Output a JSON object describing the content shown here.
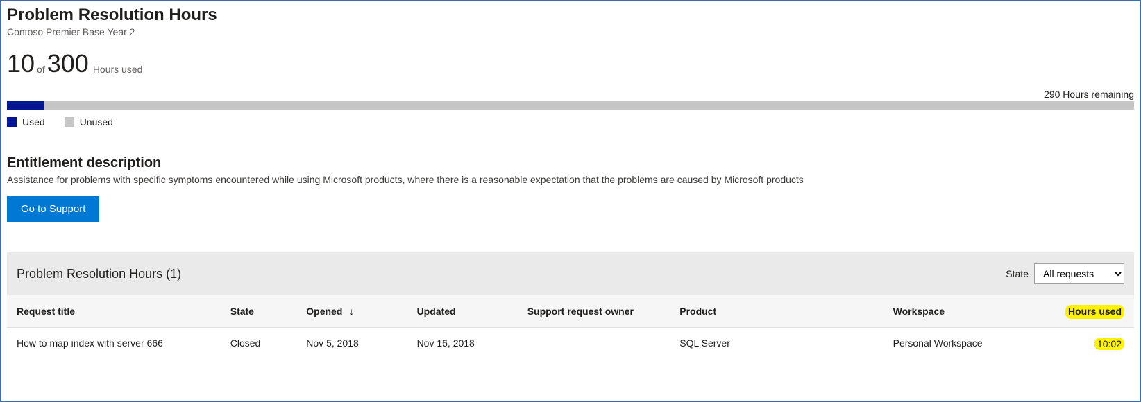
{
  "header": {
    "title": "Problem Resolution Hours",
    "subtitle": "Contoso Premier Base Year 2"
  },
  "usage": {
    "used": "10",
    "of_label": "of",
    "total": "300",
    "hours_used_label": "Hours used",
    "remaining_label": "290 Hours remaining",
    "progress_percent": 3.33
  },
  "legend": {
    "used": "Used",
    "unused": "Unused"
  },
  "entitlement": {
    "title": "Entitlement description",
    "description": "Assistance for problems with specific symptoms encountered while using Microsoft products, where there is a reasonable expectation that the problems are caused by Microsoft products",
    "button": "Go to Support"
  },
  "tableSection": {
    "title": "Problem Resolution Hours (1)",
    "state_label": "State",
    "state_selected": "All requests"
  },
  "columns": {
    "request_title": "Request title",
    "state": "State",
    "opened": "Opened",
    "updated": "Updated",
    "owner": "Support request owner",
    "product": "Product",
    "workspace": "Workspace",
    "hours_used": "Hours used"
  },
  "sort_indicator": "↓",
  "rows": [
    {
      "title": "How to map index with server 666",
      "state": "Closed",
      "opened": "Nov 5, 2018",
      "updated": "Nov 16, 2018",
      "owner": "",
      "product": "SQL Server",
      "workspace": "Personal Workspace",
      "hours_used": "10:02"
    }
  ],
  "colors": {
    "accent": "#0078d4",
    "progress_used": "#00188f",
    "progress_unused": "#c6c6c6",
    "highlight": "#fff200"
  },
  "chart_data": {
    "type": "bar",
    "title": "Problem Resolution Hours",
    "categories": [
      "Used",
      "Unused"
    ],
    "values": [
      10,
      290
    ],
    "total": 300,
    "ylabel": "Hours",
    "ylim": [
      0,
      300
    ]
  }
}
